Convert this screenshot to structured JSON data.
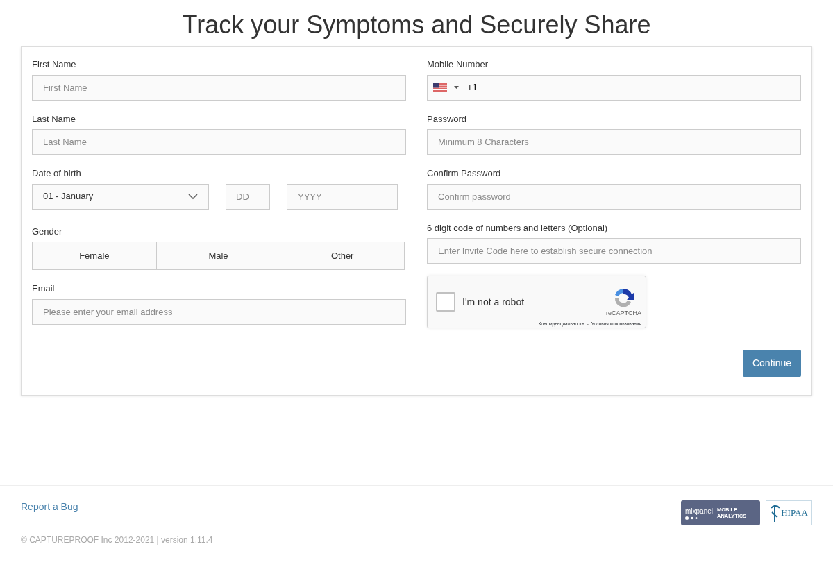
{
  "title": "Track your Symptoms and Securely Share",
  "left": [
    {
      "kind": "text",
      "label": "First Name",
      "placeholder": "First Name"
    },
    {
      "kind": "text",
      "label": "Last Name",
      "placeholder": "Last Name"
    },
    {
      "kind": "dob",
      "label": "Date of birth",
      "month": "01 - January",
      "day_placeholder": "DD",
      "year_placeholder": "YYYY"
    },
    {
      "kind": "gender",
      "label": "Gender",
      "options": [
        {
          "label": "Female",
          "selected": false
        },
        {
          "label": "Male",
          "selected": false
        },
        {
          "label": "Other",
          "selected": false
        }
      ]
    },
    {
      "kind": "text",
      "label": "Email",
      "placeholder": "Please enter your email address"
    }
  ],
  "right": [
    {
      "kind": "phone",
      "label": "Mobile Number",
      "value": "+1"
    },
    {
      "kind": "text",
      "label": "Password",
      "placeholder": "Minimum 8 Characters"
    },
    {
      "kind": "text",
      "label": "Confirm Password",
      "placeholder": "Confirm password"
    },
    {
      "kind": "text",
      "label": "6 digit code of numbers and letters (Optional)",
      "placeholder": "Enter Invite Code here to establish secure connection"
    },
    {
      "kind": "captcha",
      "label": "I'm not a robot",
      "checked": false,
      "brand": "reCAPTCHA",
      "privacy": "Конфиденциальность",
      "separator": "-",
      "terms": "Условия использования"
    }
  ],
  "continue_button": "Continue",
  "footer": {
    "report_link": "Report a Bug",
    "copyright": "© CAPTUREPROOF Inc 2012-2021 | version 1.11.4",
    "mixpanel": {
      "name": "mixpanel",
      "line1": "MOBILE",
      "line2": "ANALYTICS"
    },
    "hipaa": "HIPAA"
  }
}
